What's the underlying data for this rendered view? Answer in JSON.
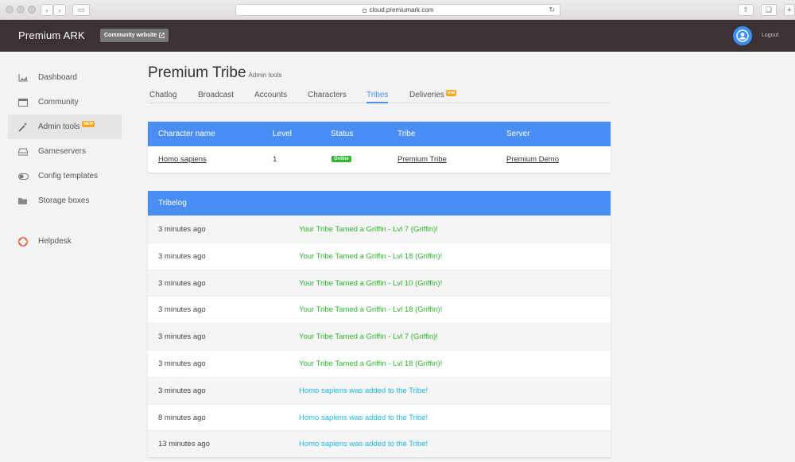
{
  "browser": {
    "url": "cloud.premiumark.com"
  },
  "header": {
    "brand": "Premium ARK",
    "community_button": "Community website",
    "logout": "Logout"
  },
  "sidebar": {
    "items": [
      {
        "label": "Dashboard",
        "icon": "chart-icon"
      },
      {
        "label": "Community",
        "icon": "window-icon"
      },
      {
        "label": "Admin tools",
        "icon": "wand-icon",
        "badge": "NEW",
        "active": true
      },
      {
        "label": "Gameservers",
        "icon": "server-icon"
      },
      {
        "label": "Config templates",
        "icon": "toggle-icon"
      },
      {
        "label": "Storage boxes",
        "icon": "folder-icon"
      }
    ],
    "help": {
      "label": "Helpdesk",
      "icon": "lifebuoy-icon"
    }
  },
  "page": {
    "title": "Premium Tribe",
    "subtitle": "Admin tools"
  },
  "tabs": [
    {
      "label": "Chatlog"
    },
    {
      "label": "Broadcast"
    },
    {
      "label": "Accounts"
    },
    {
      "label": "Characters"
    },
    {
      "label": "Tribes",
      "active": true
    },
    {
      "label": "Deliveries",
      "badge": "trial"
    }
  ],
  "characters_table": {
    "headers": [
      "Character name",
      "Level",
      "Status",
      "Tribe",
      "Server"
    ],
    "rows": [
      {
        "name": "Homo sapiens",
        "level": "1",
        "status": "Online",
        "tribe": "Premium Tribe",
        "server": "Premium Demo"
      }
    ]
  },
  "tribelog": {
    "title": "Tribelog",
    "entries": [
      {
        "time": "3 minutes ago",
        "message": "Your Tribe Tamed a Griffin - Lvl 7 (Griffin)!",
        "type": "tame"
      },
      {
        "time": "3 minutes ago",
        "message": "Your Tribe Tamed a Griffin - Lvl 18 (Griffin)!",
        "type": "tame"
      },
      {
        "time": "3 minutes ago",
        "message": "Your Tribe Tamed a Griffin - Lvl 10 (Griffin)!",
        "type": "tame"
      },
      {
        "time": "3 minutes ago",
        "message": "Your Tribe Tamed a Griffin - Lvl 18 (Griffin)!",
        "type": "tame"
      },
      {
        "time": "3 minutes ago",
        "message": "Your Tribe Tamed a Griffin - Lvl 7 (Griffin)!",
        "type": "tame"
      },
      {
        "time": "3 minutes ago",
        "message": "Your Tribe Tamed a Griffin - Lvl 18 (Griffin)!",
        "type": "tame"
      },
      {
        "time": "3 minutes ago",
        "message": "Homo sapiens was added to the Tribe!",
        "type": "join"
      },
      {
        "time": "8 minutes ago",
        "message": "Homo sapiens was added to the Tribe!",
        "type": "join"
      },
      {
        "time": "13 minutes ago",
        "message": "Homo sapiens was added to the Tribe!",
        "type": "join"
      }
    ]
  },
  "colors": {
    "accent": "#4a8ef5",
    "topbar": "#3c3233",
    "online": "#2eb82e",
    "tame": "#2db52d",
    "join": "#1ab8e0"
  }
}
